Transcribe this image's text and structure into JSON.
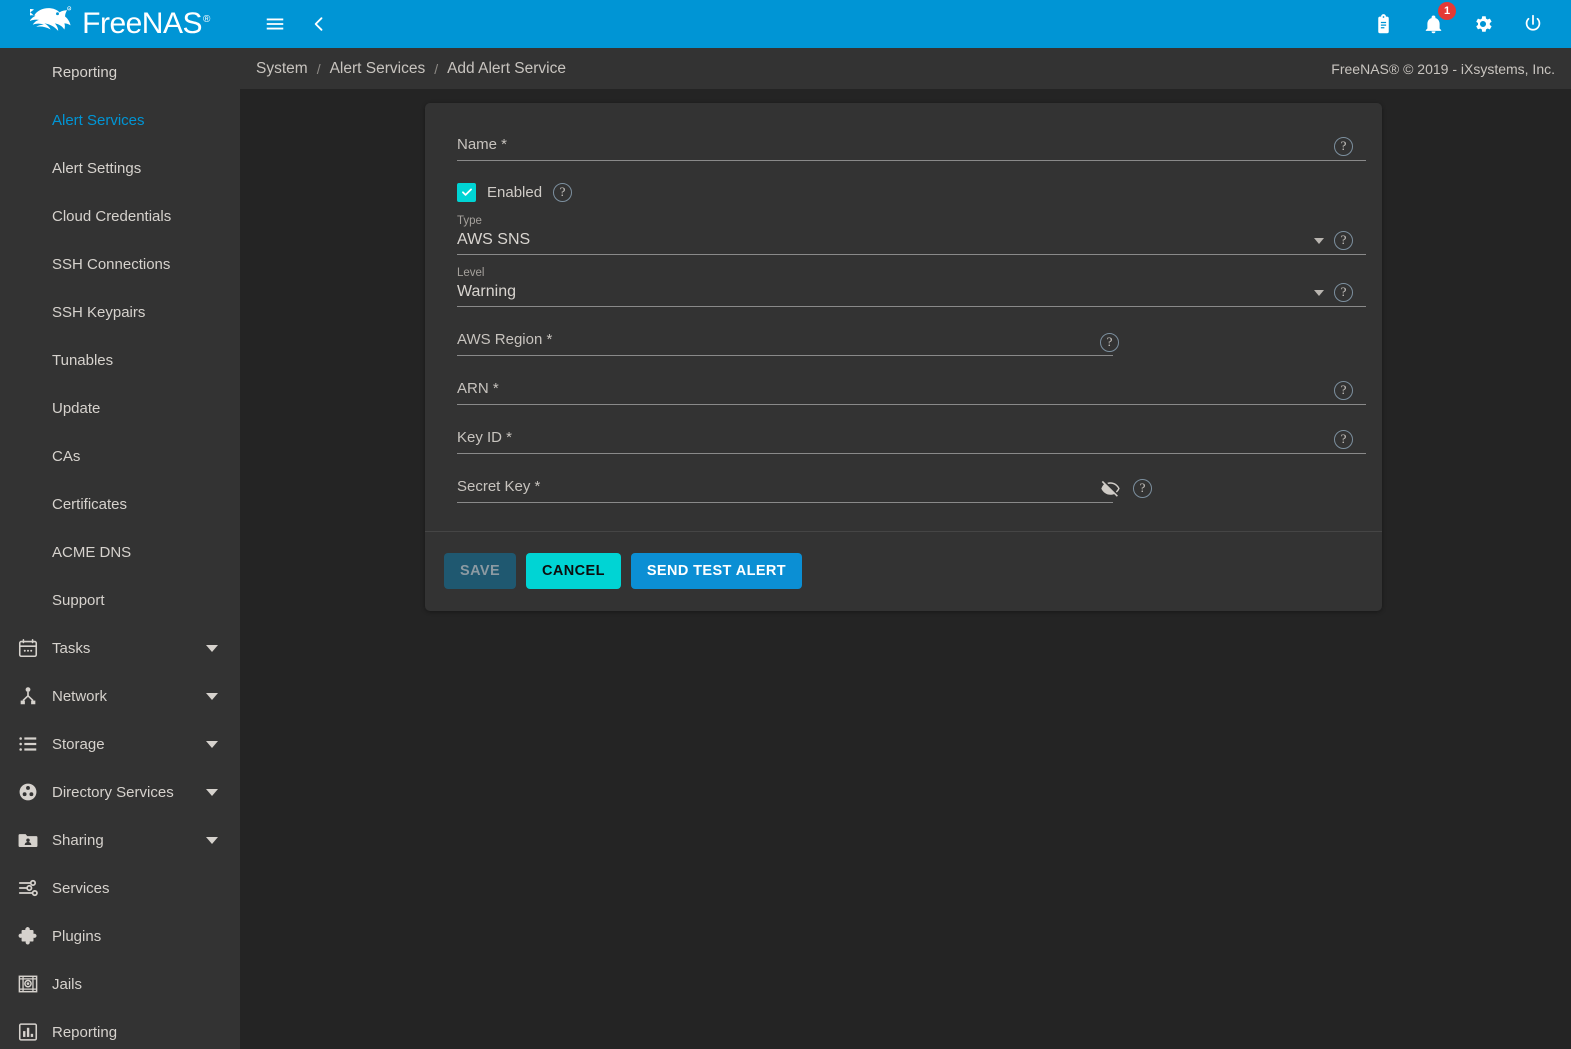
{
  "brand": {
    "name": "FreeNAS",
    "tm": "®"
  },
  "topbar": {
    "menu_icon": "hamburger-menu-icon",
    "collapse_icon": "chevron-left-icon",
    "clipboard_icon": "clipboard-icon",
    "notifications_icon": "bell-icon",
    "notifications_count": "1",
    "settings_icon": "gear-icon",
    "power_icon": "power-icon",
    "accent": "#0095d5",
    "badge_color": "#e53935"
  },
  "breadcrumb": {
    "items": [
      {
        "label": "System"
      },
      {
        "label": "Alert Services"
      },
      {
        "label": "Add Alert Service"
      }
    ],
    "separator": "/",
    "copyright": "FreeNAS® © 2019 - iXsystems, Inc."
  },
  "sidebar": {
    "items": [
      {
        "label": "Reporting",
        "icon": "",
        "active": false,
        "caret": false
      },
      {
        "label": "Alert Services",
        "icon": "",
        "active": true,
        "caret": false
      },
      {
        "label": "Alert Settings",
        "icon": "",
        "active": false,
        "caret": false
      },
      {
        "label": "Cloud Credentials",
        "icon": "",
        "active": false,
        "caret": false
      },
      {
        "label": "SSH Connections",
        "icon": "",
        "active": false,
        "caret": false
      },
      {
        "label": "SSH Keypairs",
        "icon": "",
        "active": false,
        "caret": false
      },
      {
        "label": "Tunables",
        "icon": "",
        "active": false,
        "caret": false
      },
      {
        "label": "Update",
        "icon": "",
        "active": false,
        "caret": false
      },
      {
        "label": "CAs",
        "icon": "",
        "active": false,
        "caret": false
      },
      {
        "label": "Certificates",
        "icon": "",
        "active": false,
        "caret": false
      },
      {
        "label": "ACME DNS",
        "icon": "",
        "active": false,
        "caret": false
      },
      {
        "label": "Support",
        "icon": "",
        "active": false,
        "caret": false
      },
      {
        "label": "Tasks",
        "icon": "calendar-icon",
        "active": false,
        "caret": true
      },
      {
        "label": "Network",
        "icon": "network-icon",
        "active": false,
        "caret": true
      },
      {
        "label": "Storage",
        "icon": "storage-list-icon",
        "active": false,
        "caret": true
      },
      {
        "label": "Directory Services",
        "icon": "directory-services-icon",
        "active": false,
        "caret": true
      },
      {
        "label": "Sharing",
        "icon": "folder-share-icon",
        "active": false,
        "caret": true
      },
      {
        "label": "Services",
        "icon": "sliders-icon",
        "active": false,
        "caret": false
      },
      {
        "label": "Plugins",
        "icon": "puzzle-icon",
        "active": false,
        "caret": false
      },
      {
        "label": "Jails",
        "icon": "jail-icon",
        "active": false,
        "caret": false
      },
      {
        "label": "Reporting",
        "icon": "bar-chart-icon",
        "active": false,
        "caret": false
      }
    ],
    "active_color": "#0095d5"
  },
  "form": {
    "name": {
      "label": "Name *",
      "value": "",
      "placeholder": "",
      "help": "?"
    },
    "enabled": {
      "label": "Enabled",
      "checked": true,
      "help": "?",
      "color": "#00d4d4"
    },
    "type": {
      "label": "Type",
      "value": "AWS SNS",
      "help": "?"
    },
    "level": {
      "label": "Level",
      "value": "Warning",
      "help": "?"
    },
    "aws_region": {
      "label": "AWS Region *",
      "value": "",
      "help": "?"
    },
    "arn": {
      "label": "ARN *",
      "value": "",
      "help": "?"
    },
    "key_id": {
      "label": "Key ID *",
      "value": "",
      "help": "?"
    },
    "secret_key": {
      "label": "Secret Key *",
      "value": "",
      "help": "?",
      "visibility_icon": "eye-off-icon"
    }
  },
  "buttons": {
    "save": "SAVE",
    "cancel": "CANCEL",
    "send_test": "SEND TEST ALERT",
    "save_color": "#1f5870",
    "cancel_color": "#00d4d4",
    "test_color": "#0b8fd4"
  }
}
